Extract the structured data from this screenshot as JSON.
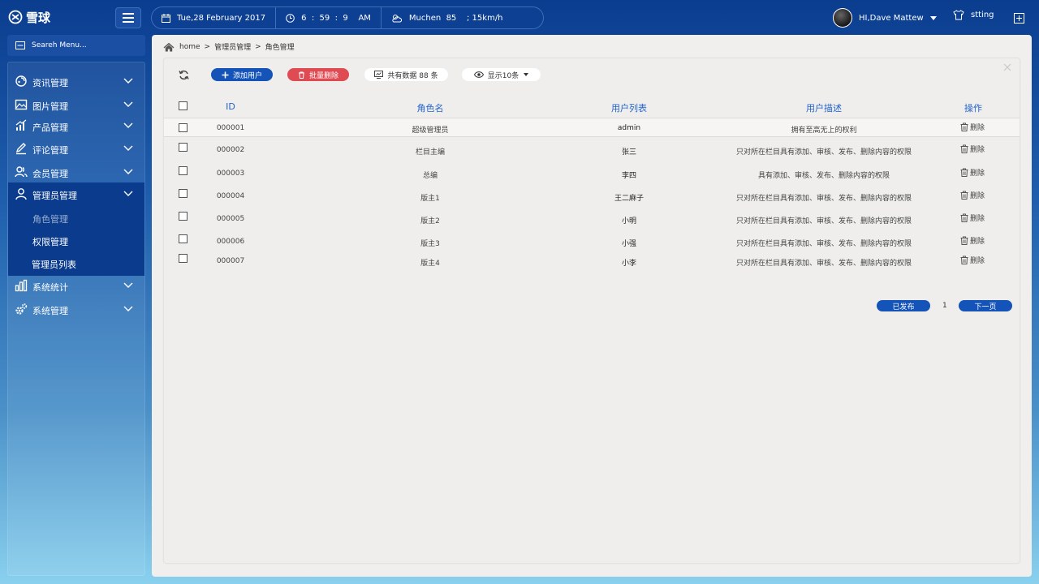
{
  "app": {
    "logo_text": "雪球"
  },
  "infobar": {
    "date": "Tue,28  February  2017",
    "time": "6  :  59  :  9    AM",
    "weather": "Muchen  85    ; 15km/h"
  },
  "user": {
    "greeting": "HI,Dave Mattew",
    "setting_label": "stting"
  },
  "sidebar": {
    "search_placeholder": "Seareh Menu...",
    "items": [
      {
        "label": "资讯管理",
        "icon": "news-icon"
      },
      {
        "label": "图片管理",
        "icon": "image-icon"
      },
      {
        "label": "产品管理",
        "icon": "chart-icon"
      },
      {
        "label": "评论管理",
        "icon": "edit-icon"
      },
      {
        "label": "会员管理",
        "icon": "members-icon"
      },
      {
        "label": "管理员管理",
        "icon": "admin-icon"
      },
      {
        "label": "系统统计",
        "icon": "stats-icon"
      },
      {
        "label": "系统管理",
        "icon": "gear-icon"
      }
    ],
    "submenu": [
      {
        "label": "角色管理"
      },
      {
        "label": "权限管理"
      },
      {
        "label": "管理员列表"
      }
    ]
  },
  "breadcrumb": {
    "home": "home",
    "level1": "管理员管理",
    "level2": "角色管理",
    "separator": ">"
  },
  "toolbar": {
    "add_label": "添加用户",
    "batch_delete_label": "批量删除",
    "total_label": "共有数据 88 条",
    "show_label": "显示10条"
  },
  "table": {
    "headers": {
      "id": "ID",
      "role": "角色名",
      "users": "用户列表",
      "desc": "用户描述",
      "ops": "操作"
    },
    "delete_label": "删除",
    "rows": [
      {
        "id": "000001",
        "role": "超级管理员",
        "users": "admin",
        "desc": "拥有至高无上的权利"
      },
      {
        "id": "000002",
        "role": "栏目主编",
        "users": "张三",
        "desc": "只对所在栏目具有添加、审核、发布、删除内容的权限"
      },
      {
        "id": "000003",
        "role": "总编",
        "users": "李四",
        "desc": "具有添加、审核、发布、删除内容的权限"
      },
      {
        "id": "000004",
        "role": "版主1",
        "users": "王二麻子",
        "desc": "只对所在栏目具有添加、审核、发布、删除内容的权限"
      },
      {
        "id": "000005",
        "role": "版主2",
        "users": "小明",
        "desc": "只对所在栏目具有添加、审核、发布、删除内容的权限"
      },
      {
        "id": "000006",
        "role": "版主3",
        "users": "小强",
        "desc": "只对所在栏目具有添加、审核、发布、删除内容的权限"
      },
      {
        "id": "000007",
        "role": "版主4",
        "users": "小李",
        "desc": "只对所在栏目具有添加、审核、发布、删除内容的权限"
      }
    ]
  },
  "pager": {
    "prev_label": "已发布",
    "page": "1",
    "next_label": "下一页"
  },
  "colors": {
    "primary": "#1453b8",
    "danger": "#de4b52",
    "header_text": "#2464c9",
    "nav_active": "#0a3b8c"
  }
}
